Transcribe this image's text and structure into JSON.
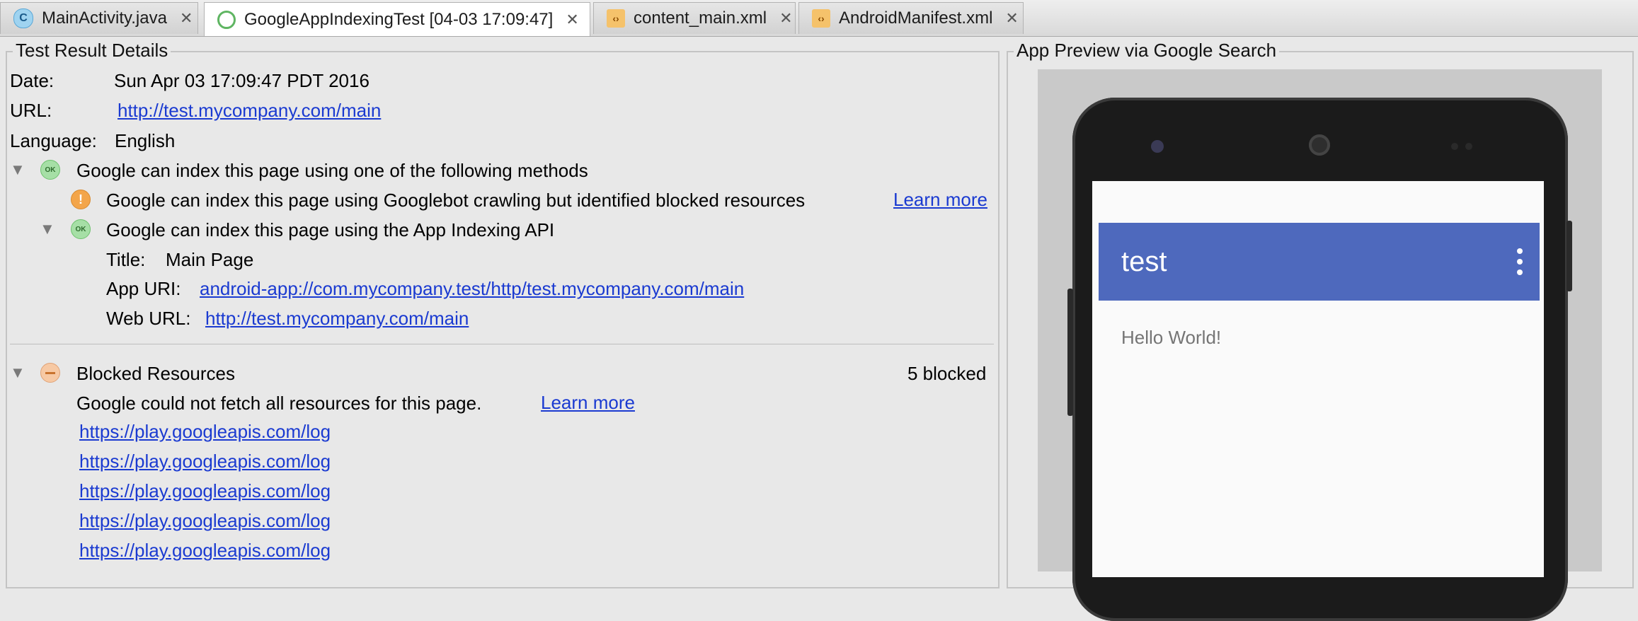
{
  "tabs": [
    {
      "label": "MainActivity.java",
      "icon": "class-c-icon",
      "active": false
    },
    {
      "label": "GoogleAppIndexingTest [04-03 17:09:47]",
      "icon": "magnifier-icon",
      "active": true
    },
    {
      "label": "content_main.xml",
      "icon": "xml-file-icon",
      "active": false
    },
    {
      "label": "AndroidManifest.xml",
      "icon": "xml-file-icon",
      "active": false
    }
  ],
  "details": {
    "title": "Test Result Details",
    "date_label": "Date:",
    "date_value": "Sun Apr 03 17:09:47 PDT 2016",
    "url_label": "URL:",
    "url_value": "http://test.mycompany.com/main",
    "language_label": "Language:",
    "language_value": "English",
    "index_heading": "Google can index this page using one of the following methods",
    "googlebot_text": "Google can index this page using Googlebot crawling but identified blocked resources",
    "learn_more": "Learn more",
    "api_text": "Google can index this page using the App Indexing API",
    "title_label": "Title:",
    "title_value": "Main Page",
    "app_uri_label": "App URI:",
    "app_uri_value": "android-app://com.mycompany.test/http/test.mycompany.com/main",
    "web_url_label": "Web URL:",
    "web_url_value": "http://test.mycompany.com/main",
    "blocked_heading": "Blocked Resources",
    "blocked_count": "5 blocked",
    "blocked_desc": "Google could not fetch all resources for this page.",
    "blocked_learn_more": "Learn more",
    "blocked_urls": [
      "https://play.googleapis.com/log",
      "https://play.googleapis.com/log",
      "https://play.googleapis.com/log",
      "https://play.googleapis.com/log",
      "https://play.googleapis.com/log"
    ]
  },
  "preview": {
    "title": "App Preview via Google Search",
    "app_title": "test",
    "content_text": "Hello World!"
  },
  "colors": {
    "link": "#1a3ad1",
    "app_bar": "#4e69bd",
    "ok": "#a6dfa6",
    "warning": "#f3a54a"
  }
}
